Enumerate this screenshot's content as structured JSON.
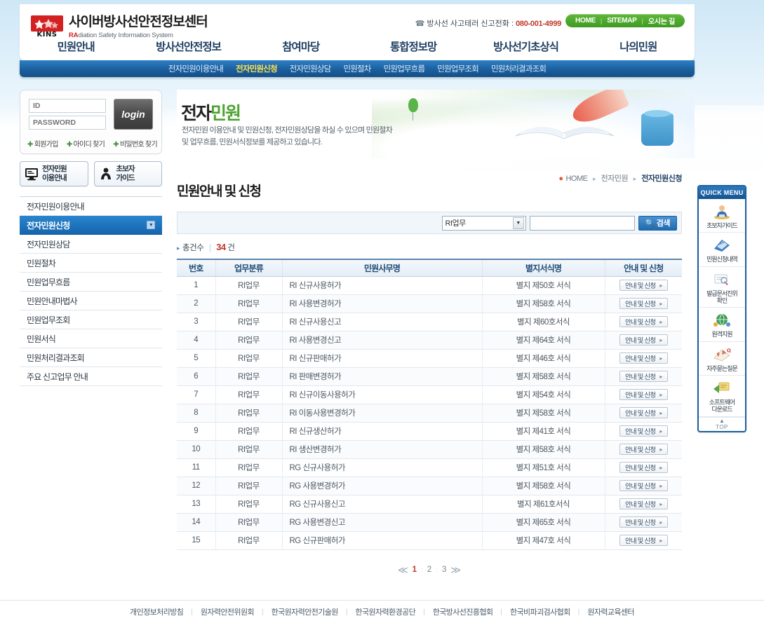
{
  "header": {
    "logo_ko": "사이버방사선안전정보센터",
    "logo_en_prefix": "RA",
    "logo_en_rest": "diation Safety Information System",
    "logo_badge": "KINS",
    "hotline_label": "방사선 사고테러 신고전화 :",
    "hotline_number": "080-001-4999",
    "top_links": [
      "HOME",
      "SITEMAP",
      "오시는 길"
    ]
  },
  "gnb": {
    "items": [
      "민원안내",
      "방사선안전정보",
      "참여마당",
      "통합정보망",
      "방사선기초상식",
      "나의민원"
    ]
  },
  "lnb": {
    "items": [
      {
        "label": "전자민원이용안내",
        "active": false
      },
      {
        "label": "전자민원신청",
        "active": true
      },
      {
        "label": "전자민원상담",
        "active": false
      },
      {
        "label": "민원절차",
        "active": false
      },
      {
        "label": "민원업무흐름",
        "active": false
      },
      {
        "label": "민원업무조회",
        "active": false
      },
      {
        "label": "민원처리결과조회",
        "active": false
      }
    ]
  },
  "login": {
    "id_placeholder": "ID",
    "pw_placeholder": "PASSWORD",
    "button": "login",
    "links": [
      "회원가입",
      "아이디 찾기",
      "비밀번호 찾기"
    ]
  },
  "side_buttons": [
    {
      "line1": "전자민원",
      "line2": "이용안내",
      "icon": "monitor-icon"
    },
    {
      "line1": "초보자",
      "line2": "가이드",
      "icon": "person-icon"
    }
  ],
  "sidebar": {
    "items": [
      {
        "label": "전자민원이용안내",
        "active": false
      },
      {
        "label": "전자민원신청",
        "active": true
      },
      {
        "label": "전자민원상담",
        "active": false
      },
      {
        "label": "민원절차",
        "active": false
      },
      {
        "label": "민원업무흐름",
        "active": false
      },
      {
        "label": "민원안내마법사",
        "active": false
      },
      {
        "label": "민원업무조회",
        "active": false
      },
      {
        "label": "민원서식",
        "active": false
      },
      {
        "label": "민원처리결과조회",
        "active": false
      },
      {
        "label": "주요 신고업무 안내",
        "active": false
      }
    ]
  },
  "banner": {
    "title_a": "전자",
    "title_b": "민원",
    "desc_line1": "전자민원 이용안내 및 민원신청, 전자민원상담을 하실 수 있으며 민원절차",
    "desc_line2": "및 업무흐름, 민원서식정보를 제공하고 있습니다."
  },
  "breadcrumb": {
    "home": "HOME",
    "mid": "전자민원",
    "current": "전자민원신청"
  },
  "page": {
    "title": "민원안내 및 신청"
  },
  "search": {
    "select_value": "RI업무",
    "input_value": "",
    "input_placeholder": "",
    "button": "검색"
  },
  "result": {
    "count_label": "총건수",
    "count": "34",
    "unit": "건"
  },
  "table": {
    "headers": [
      "번호",
      "업무분류",
      "민원사무명",
      "별지서식명",
      "안내 및 신청"
    ],
    "action_label": "안내 및 신청",
    "rows": [
      {
        "no": "1",
        "cat": "RI업무",
        "name": "RI 신규사용허가",
        "form": "별지 제50호 서식"
      },
      {
        "no": "2",
        "cat": "RI업무",
        "name": "RI 사용변경허가",
        "form": "별지 제58호 서식"
      },
      {
        "no": "3",
        "cat": "RI업무",
        "name": "RI 신규사용신고",
        "form": "별지 제60호서식"
      },
      {
        "no": "4",
        "cat": "RI업무",
        "name": "RI 사용변경신고",
        "form": "별지 제64호 서식"
      },
      {
        "no": "5",
        "cat": "RI업무",
        "name": "RI 신규판매허가",
        "form": "별지 제46호 서식"
      },
      {
        "no": "6",
        "cat": "RI업무",
        "name": "RI 판매변경허가",
        "form": "별지 제58호 서식"
      },
      {
        "no": "7",
        "cat": "RI업무",
        "name": "RI 신규이동사용허가",
        "form": "별지 제54호 서식"
      },
      {
        "no": "8",
        "cat": "RI업무",
        "name": "RI 이동사용변경허가",
        "form": "별지 제58호 서식"
      },
      {
        "no": "9",
        "cat": "RI업무",
        "name": "RI 신규생산허가",
        "form": "별지 제41호 서식"
      },
      {
        "no": "10",
        "cat": "RI업무",
        "name": "RI 생산변경허가",
        "form": "별지 제58호 서식"
      },
      {
        "no": "11",
        "cat": "RI업무",
        "name": "RG 신규사용허가",
        "form": "별지 제51호 서식"
      },
      {
        "no": "12",
        "cat": "RI업무",
        "name": "RG 사용변경허가",
        "form": "별지 제58호 서식"
      },
      {
        "no": "13",
        "cat": "RI업무",
        "name": "RG 신규사용신고",
        "form": "별지 제61호서식"
      },
      {
        "no": "14",
        "cat": "RI업무",
        "name": "RG 사용변경신고",
        "form": "별지 제65호 서식"
      },
      {
        "no": "15",
        "cat": "RI업무",
        "name": "RG 신규판매허가",
        "form": "별지 제47호 서식"
      }
    ]
  },
  "pagination": {
    "prev": "≪",
    "next": "≫",
    "pages": [
      "1",
      "2",
      "3"
    ],
    "current": "1"
  },
  "quick_menu": {
    "title": "QUICK MENU",
    "items": [
      {
        "label": "초보자가이드",
        "icon": "person-guide-icon"
      },
      {
        "label": "민원신청내역",
        "icon": "document-list-icon"
      },
      {
        "label": "발급문서진위\n확인",
        "icon": "certificate-icon"
      },
      {
        "label": "원격지원",
        "icon": "globe-icon"
      },
      {
        "label": "자주묻는질문",
        "icon": "faq-icon"
      },
      {
        "label": "소프트웨어\n다운로드",
        "icon": "download-icon"
      }
    ],
    "top_label": "TOP"
  },
  "footer": {
    "links": [
      "개인정보처리방침",
      "원자력안전위원회",
      "한국원자력안전기술원",
      "한국원자력환경공단",
      "한국방사선진흥협회",
      "한국비파괴검사협회",
      "원자력교육센터"
    ]
  },
  "colors": {
    "brand_blue": "#1f5f9e",
    "accent_green": "#4da32f",
    "logo_red": "#d32020",
    "highlight_yellow": "#ffe14d",
    "count_red": "#c0392b"
  }
}
